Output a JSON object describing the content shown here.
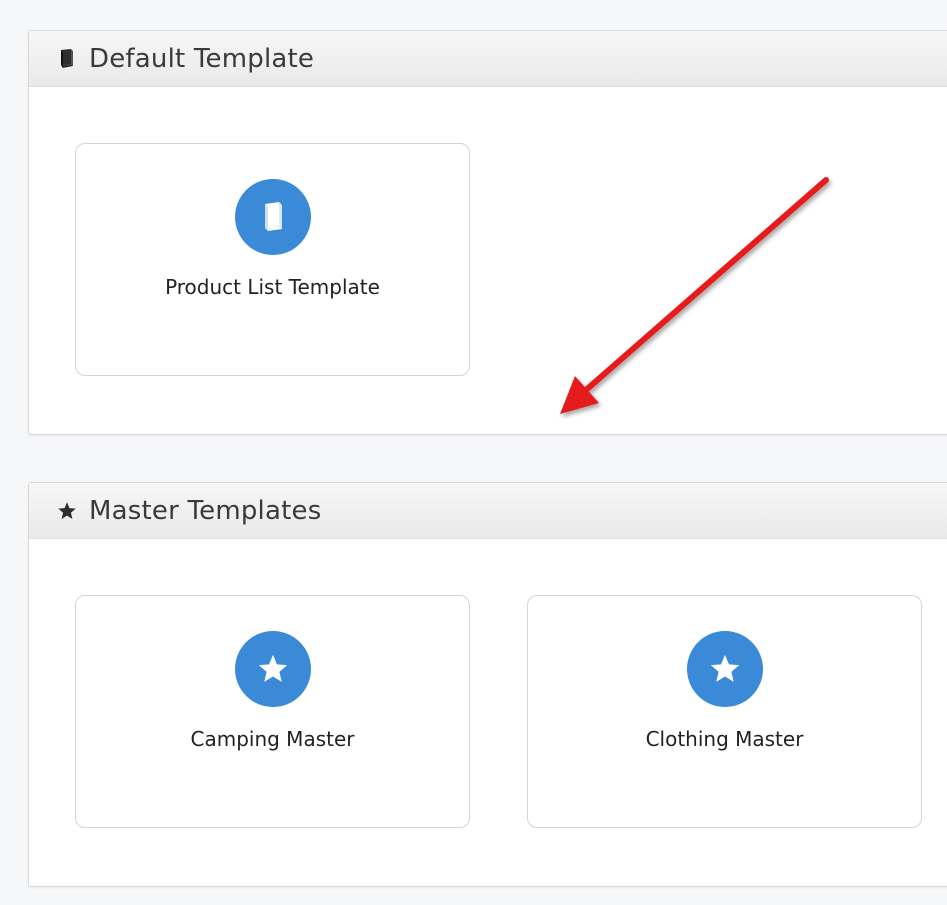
{
  "default_panel": {
    "title": "Default Template",
    "icon": "book-icon",
    "tiles": [
      {
        "label": "Product List Template",
        "icon": "book-icon"
      }
    ]
  },
  "master_panel": {
    "title": "Master Templates",
    "icon": "star-icon",
    "tiles": [
      {
        "label": "Camping Master",
        "icon": "star-icon"
      },
      {
        "label": "Clothing Master",
        "icon": "star-icon"
      }
    ]
  },
  "annotation": {
    "icon": "red-arrow-annotation",
    "color": "#e61f1f"
  },
  "colors": {
    "accent": "#3a8ad8",
    "page_bg": "#f6f7f9"
  }
}
